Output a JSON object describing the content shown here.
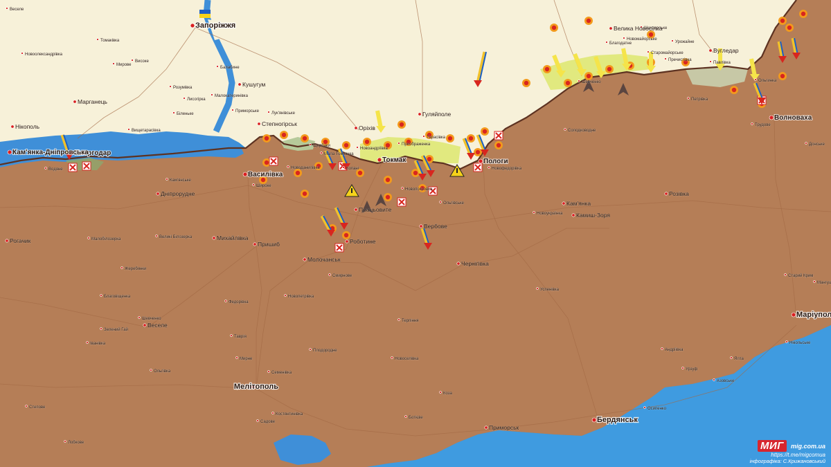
{
  "colors": {
    "sea": "#2f8fd9",
    "occupied": "#b57e57",
    "free": "#f7f1d9",
    "contested": "#dfe87a",
    "gray_zone": "#c7c8a6",
    "river": "#3f8fd8",
    "road": "#a36a45",
    "front_line": "#5d3221",
    "city_dot": "#d92020"
  },
  "major_cities": [
    {
      "name": "Запоріжжя"
    },
    {
      "name": "Мелітополь"
    },
    {
      "name": "Бердянськ"
    },
    {
      "name": "Маріуполь"
    },
    {
      "name": "Енергодар"
    },
    {
      "name": "Пологи"
    },
    {
      "name": "Токмак"
    },
    {
      "name": "Василівка"
    },
    {
      "name": "Волноваха"
    },
    {
      "name": "Кам'янка-Дніпровська"
    }
  ],
  "towns": [
    {
      "name": "Нікополь"
    },
    {
      "name": "Марганець"
    },
    {
      "name": "Оріхів"
    },
    {
      "name": "Гуляйполе"
    },
    {
      "name": "Михайлівка"
    },
    {
      "name": "Молочанськ"
    },
    {
      "name": "Пришиб"
    },
    {
      "name": "Дніпрорудне"
    },
    {
      "name": "Веселе"
    },
    {
      "name": "Приморськ"
    },
    {
      "name": "Чернігівка"
    },
    {
      "name": "Кам'янка"
    },
    {
      "name": "Камиш-Зоря"
    },
    {
      "name": "Розівка"
    },
    {
      "name": "Вугледар"
    },
    {
      "name": "Велика Новосілка"
    },
    {
      "name": "Рогачик"
    },
    {
      "name": "Степногірськ"
    },
    {
      "name": "Кушугум"
    },
    {
      "name": "Роботине"
    },
    {
      "name": "Вербове"
    },
    {
      "name": "Працьовите"
    }
  ],
  "villages": [
    {
      "name": "Веселе"
    },
    {
      "name": "Томаківка"
    },
    {
      "name": "Новоолександрівка"
    },
    {
      "name": "Мирове"
    },
    {
      "name": "Високе"
    },
    {
      "name": "Розумівка"
    },
    {
      "name": "Балабине"
    },
    {
      "name": "Біленьке"
    },
    {
      "name": "Лисогірка"
    },
    {
      "name": "Вищетарасівка"
    },
    {
      "name": "Малокатеринівка"
    },
    {
      "name": "Приморське"
    },
    {
      "name": "Лук'янівське"
    },
    {
      "name": "Мала Токмачка"
    },
    {
      "name": "Новоданилівка"
    },
    {
      "name": "Копані"
    },
    {
      "name": "Новопокровка"
    },
    {
      "name": "Ольгівське"
    },
    {
      "name": "Новофедорівка"
    },
    {
      "name": "Шевченко"
    },
    {
      "name": "Благодатне"
    },
    {
      "name": "Старомайорське"
    },
    {
      "name": "Урожайне"
    },
    {
      "name": "Пречистівка"
    },
    {
      "name": "Новомайорське"
    },
    {
      "name": "Павлівка"
    },
    {
      "name": "Шахтарське"
    },
    {
      "name": "Петрівка"
    },
    {
      "name": "Ольгинка"
    },
    {
      "name": "Трудове"
    },
    {
      "name": "Донське"
    },
    {
      "name": "Старий Крим"
    },
    {
      "name": "Ялта"
    },
    {
      "name": "Урзуф"
    },
    {
      "name": "Мангуш"
    },
    {
      "name": "Нікольське"
    },
    {
      "name": "Андріївка"
    },
    {
      "name": "Осипенко"
    },
    {
      "name": "Азовське"
    },
    {
      "name": "Солодководне"
    },
    {
      "name": "Новоукраїнка"
    },
    {
      "name": "Успенівка"
    },
    {
      "name": "Терпіння"
    },
    {
      "name": "Костянтинівка"
    },
    {
      "name": "Семенівка"
    },
    {
      "name": "Мирне"
    },
    {
      "name": "Садове"
    },
    {
      "name": "Плодородне"
    },
    {
      "name": "Ольгівка"
    },
    {
      "name": "Шевченко"
    },
    {
      "name": "Таврія"
    },
    {
      "name": "Іванівка"
    },
    {
      "name": "Малобілозерка"
    },
    {
      "name": "Благовіщенка"
    },
    {
      "name": "Водяне"
    },
    {
      "name": "Великі Білозерка"
    },
    {
      "name": "Широке"
    },
    {
      "name": "Кам'янське"
    },
    {
      "name": "Степове"
    },
    {
      "name": "Лобкове"
    },
    {
      "name": "Жеребянки"
    },
    {
      "name": "Щербаки"
    },
    {
      "name": "Новоандріївка"
    },
    {
      "name": "Преображенка"
    },
    {
      "name": "Тарасівка"
    },
    {
      "name": "Федорівка"
    },
    {
      "name": "Новопетрівка"
    },
    {
      "name": "Смирнове"
    },
    {
      "name": "Новоселівка"
    },
    {
      "name": "Зелений Гай"
    },
    {
      "name": "Ботієве"
    },
    {
      "name": "Коза"
    }
  ],
  "attribution": {
    "brand": "МИГ",
    "site": "mig.com.ua",
    "telegram": "https://t.me/migcomua",
    "author": "інфографіка: С.Крижановський"
  }
}
